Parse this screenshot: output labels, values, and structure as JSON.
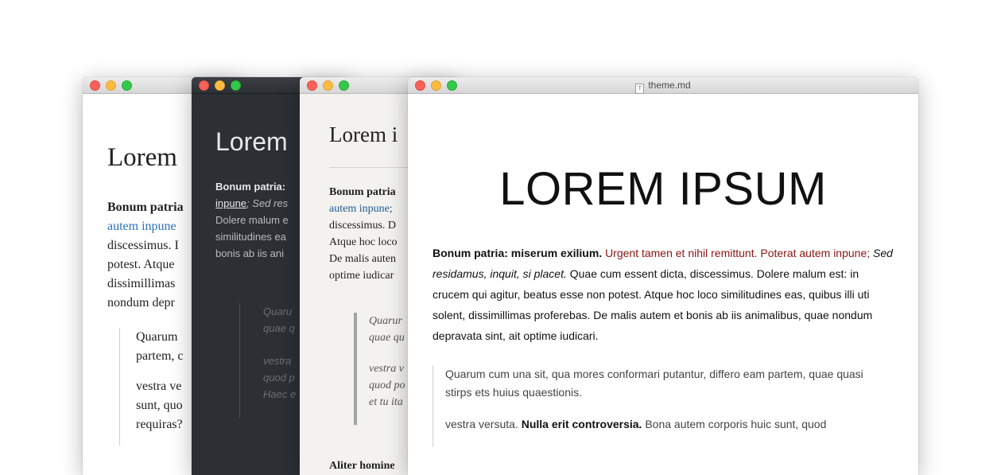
{
  "win1": {
    "heading": "Lorem",
    "p_bold": "Bonum patria",
    "p_link": "autem inpune",
    "p_lines": [
      "discessimus. I",
      "potest. Atque",
      "dissimillimas",
      "nondum depr"
    ],
    "bq1": [
      "Quarum",
      "partem, c"
    ],
    "bq2": [
      "vestra ve",
      "sunt, quo",
      "requiras?"
    ]
  },
  "win2": {
    "heading": "Lorem",
    "p_bold": "Bonum patria:",
    "p_underline": "inpune",
    "p_italic": "; Sed res",
    "p_lines": [
      "Dolere malum e",
      "similitudines ea",
      "bonis ab iis ani"
    ],
    "bq1": [
      "Quaru",
      "quae q"
    ],
    "bq2": [
      "vestra",
      "quod p",
      "Haec e"
    ]
  },
  "win3": {
    "heading": "Lorem i",
    "p_bold": "Bonum patria",
    "p_link": "autem inpune;",
    "p_lines": [
      "discessimus. D",
      "Atque hoc loco",
      "De malis auten",
      "optime iudicar"
    ],
    "bq1": [
      "Quarur",
      "quae qu"
    ],
    "bq2": [
      "vestra v",
      "quod po",
      "et tu ita"
    ],
    "p2": "Aliter homine"
  },
  "win4": {
    "title": "theme.md",
    "doc_icon": "T",
    "heading": "LOREM IPSUM",
    "p_bold": "Bonum patria: miserum exilium.",
    "p_red": "Urgent tamen et nihil remittunt. Poterat autem inpune;",
    "p_italic": "Sed residamus, inquit, si placet.",
    "p_rest": "Quae cum essent dicta, discessimus. Dolere malum est: in crucem qui agitur, beatus esse non potest. Atque hoc loco similitudines eas, quibus illi uti solent, dissimillimas proferebas. De malis autem et bonis ab iis animalibus, quae nondum depravata sint, ait optime iudicari.",
    "bq1": "Quarum cum una sit, qua mores conformari putantur, differo eam partem, quae quasi stirps ets huius quaestionis.",
    "bq2_start": "vestra versuta.",
    "bq2_bold": "Nulla erit controversia.",
    "bq2_rest": "Bona autem corporis huic sunt, quod"
  },
  "colors": {
    "link_blue": "#2a73b8",
    "red_text": "#8a1414",
    "dark_bg": "#2c2f34",
    "cream_bg": "#f3f2ee"
  }
}
